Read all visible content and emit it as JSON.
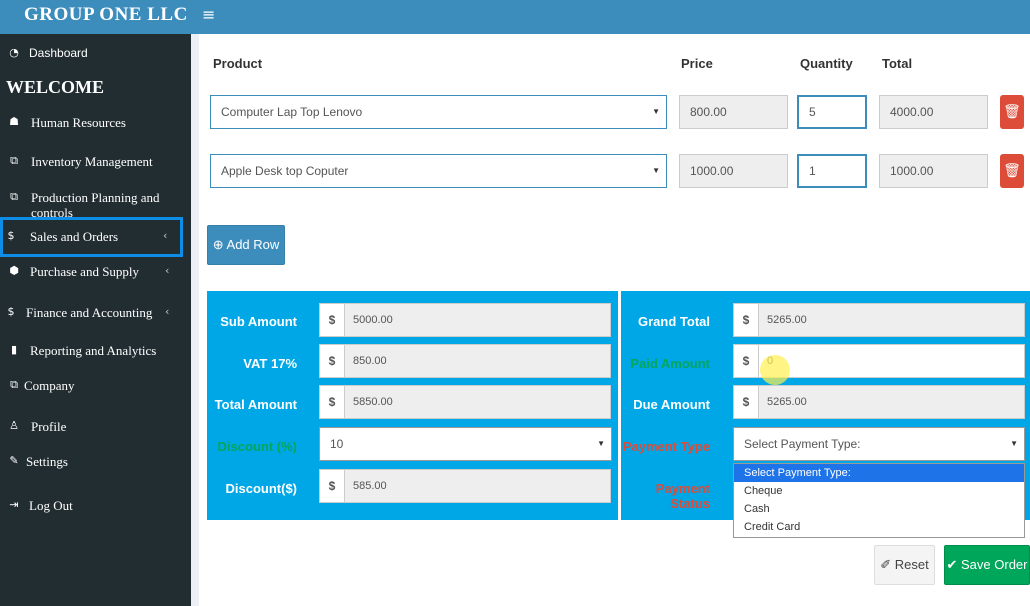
{
  "app": {
    "brand": "GROUP ONE LLC",
    "menu_icon": "bars-icon"
  },
  "sidebar": {
    "welcome": "WELCOME",
    "items": [
      {
        "label": "Dashboard",
        "icon": "dashboard-icon"
      },
      {
        "label": "Human Resources",
        "icon": "users-icon"
      },
      {
        "label": "Inventory Management",
        "icon": "copy-icon"
      },
      {
        "label": "Production Planning and controls",
        "icon": "copy-icon"
      },
      {
        "label": "Sales and Orders",
        "icon": "dollar-icon",
        "active": true
      },
      {
        "label": "Purchase and Supply",
        "icon": "cube-icon"
      },
      {
        "label": "Finance and Accounting",
        "icon": "dollar-icon"
      },
      {
        "label": "Reporting and Analytics",
        "icon": "bar-chart-icon"
      },
      {
        "label": "Company",
        "icon": "copy-icon"
      },
      {
        "label": "Profile",
        "icon": "user-icon"
      },
      {
        "label": "Settings",
        "icon": "wrench-icon"
      },
      {
        "label": "Log Out",
        "icon": "sign-out-icon"
      }
    ]
  },
  "order": {
    "headers": {
      "product": "Product",
      "price": "Price",
      "quantity": "Quantity",
      "total": "Total"
    },
    "rows": [
      {
        "product": "Computer Lap Top Lenovo",
        "price": "800.00",
        "quantity": "5",
        "total": "4000.00"
      },
      {
        "product": "Apple Desk top Coputer",
        "price": "1000.00",
        "quantity": "1",
        "total": "1000.00"
      }
    ],
    "add_row": "Add Row"
  },
  "summary": {
    "currency": "$",
    "sub_amount": {
      "label": "Sub Amount",
      "value": "5000.00"
    },
    "vat": {
      "label": "VAT 17%",
      "value": "850.00"
    },
    "total_amount": {
      "label": "Total Amount",
      "value": "5850.00"
    },
    "discount_pct": {
      "label": "Discount (%)",
      "value": "10"
    },
    "discount_amt": {
      "label": "Discount($)",
      "value": "585.00"
    },
    "grand_total": {
      "label": "Grand Total",
      "value": "5265.00"
    },
    "paid_amount": {
      "label": "Paid Amount",
      "value": "0"
    },
    "due_amount": {
      "label": "Due Amount",
      "value": "5265.00"
    },
    "payment_type": {
      "label": "Payment Type",
      "selected": "Select Payment Type:",
      "options": [
        "Select Payment Type:",
        "Cheque",
        "Cash",
        "Credit Card"
      ]
    },
    "payment_status": {
      "label": "Payment Status"
    }
  },
  "actions": {
    "reset": "Reset",
    "save": "Save Order"
  },
  "colors": {
    "topbar": "#3c8dbc",
    "sidebar": "#222d32",
    "panel": "#00a7e7",
    "save": "#00a65a",
    "danger": "#dd4b39",
    "active_outline": "#0d8de6"
  }
}
